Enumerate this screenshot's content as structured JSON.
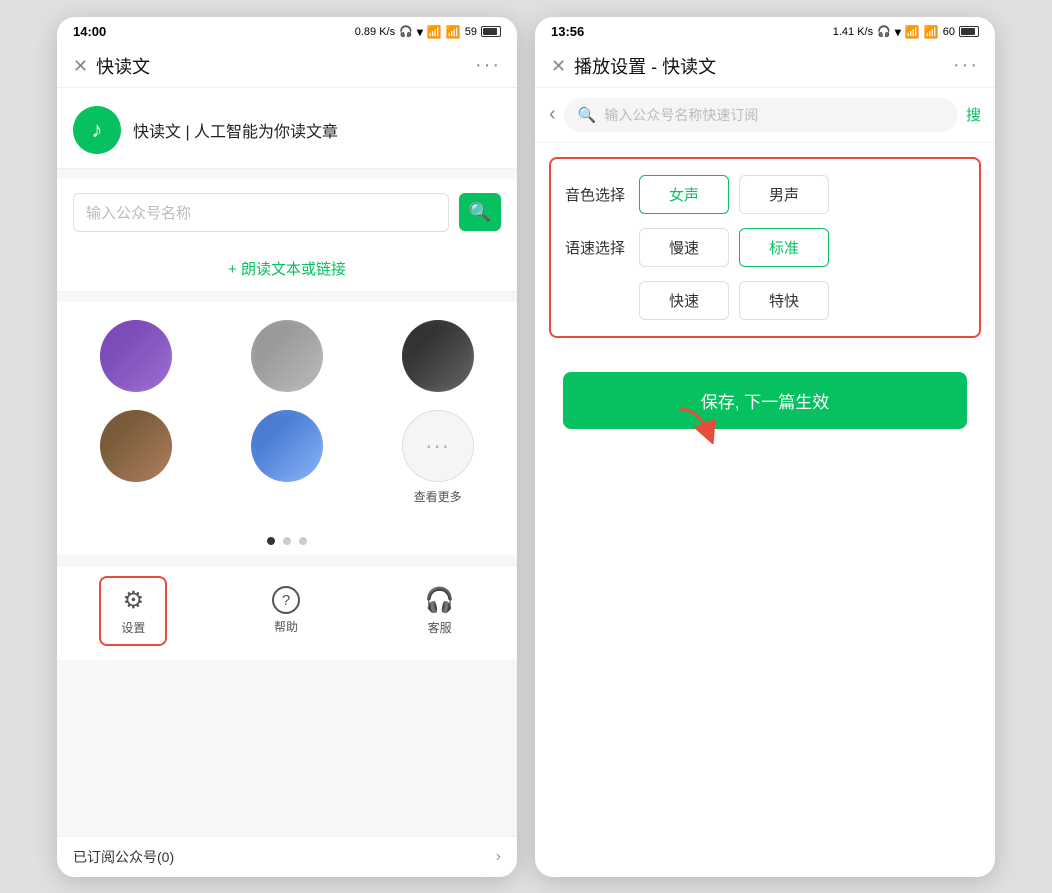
{
  "phone1": {
    "status": {
      "time": "14:00",
      "network": "0.89 K/s",
      "icons": "🎧 ▾ 📶 📶 59",
      "battery": "59"
    },
    "title": "快读文",
    "more": "···",
    "app": {
      "slogan": "快读文 | 人工智能为你读文章"
    },
    "search": {
      "placeholder": "输入公众号名称",
      "button_icon": "🔍"
    },
    "add_link": "+ 朗读文本或链接",
    "avatars": [
      {
        "id": 1,
        "color": "purple"
      },
      {
        "id": 2,
        "color": "gray"
      },
      {
        "id": 3,
        "color": "dark"
      },
      {
        "id": 4,
        "color": "brown"
      },
      {
        "id": 5,
        "color": "blue"
      },
      {
        "id": 6,
        "color": "more",
        "label": "查看更多"
      }
    ],
    "bottom_items": [
      {
        "label": "设置",
        "icon": "⚙",
        "active": true
      },
      {
        "label": "帮助",
        "icon": "?"
      },
      {
        "label": "客服",
        "icon": "🎧"
      }
    ],
    "footer": {
      "text": "已订阅公众号(0)",
      "arrow": "›"
    }
  },
  "phone2": {
    "status": {
      "time": "13:56",
      "network": "1.41 K/s",
      "battery": "60"
    },
    "title": "播放设置 - 快读文",
    "more": "···",
    "search": {
      "placeholder": "输入公众号名称快速订阅",
      "confirm": "搜"
    },
    "settings": {
      "voice_label": "音色选择",
      "speed_label": "语速选择",
      "voice_options": [
        {
          "label": "女声",
          "selected": true
        },
        {
          "label": "男声",
          "selected": false
        }
      ],
      "speed_options": [
        {
          "label": "慢速",
          "selected": false
        },
        {
          "label": "标准",
          "selected": true
        },
        {
          "label": "快速",
          "selected": false
        },
        {
          "label": "特快",
          "selected": false
        }
      ]
    },
    "save_btn": "保存, 下一篇生效"
  }
}
